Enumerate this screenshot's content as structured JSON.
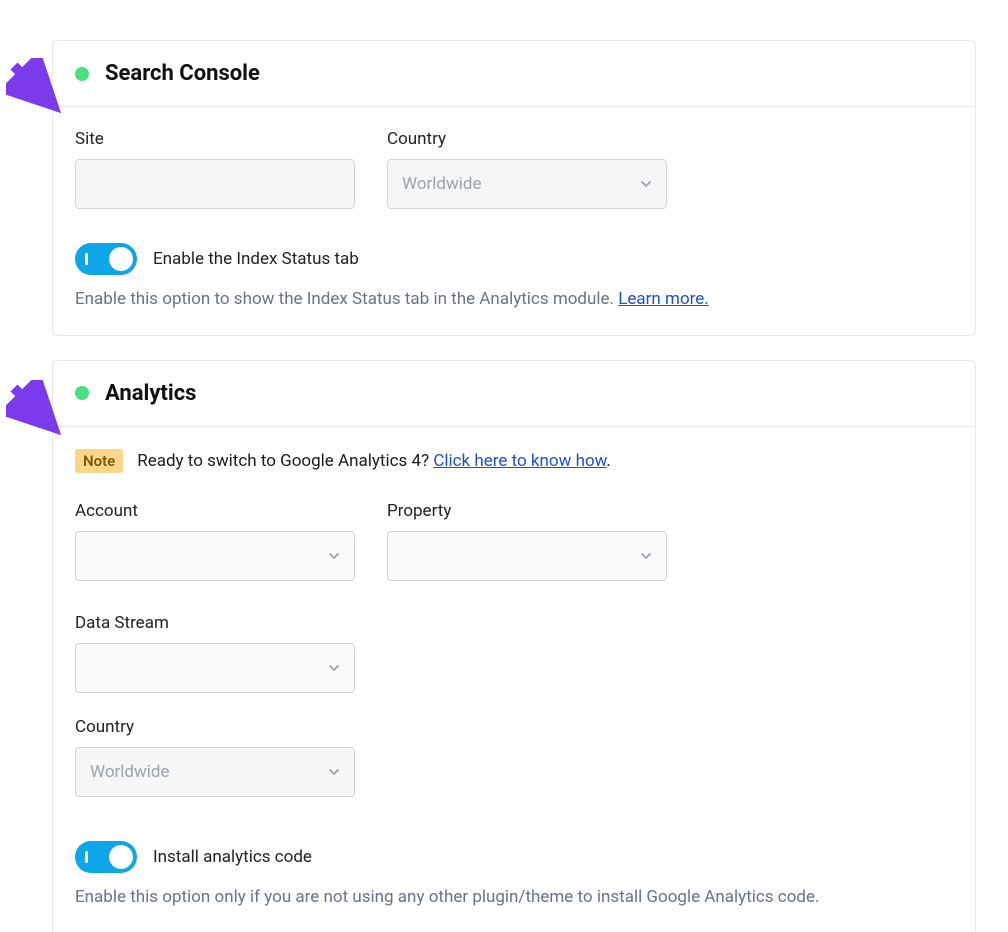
{
  "colors": {
    "status": "#4ade80",
    "toggle": "#0ea5e9",
    "arrow": "#7c3aed",
    "link": "#1d4ed8",
    "badge_bg": "#fcd78a"
  },
  "search_console": {
    "title": "Search Console",
    "site_label": "Site",
    "site_value": "",
    "country_label": "Country",
    "country_value": "Worldwide",
    "toggle_label": "Enable the Index Status tab",
    "toggle_on": true,
    "help_text": "Enable this option to show the Index Status tab in the Analytics module. ",
    "learn_more": "Learn more."
  },
  "analytics": {
    "title": "Analytics",
    "note_badge": "Note",
    "note_text": "Ready to switch to Google Analytics 4? ",
    "note_link": "Click here to know how",
    "note_suffix": ".",
    "account_label": "Account",
    "account_value": "",
    "property_label": "Property",
    "property_value": "",
    "datastream_label": "Data Stream",
    "datastream_value": "",
    "country_label": "Country",
    "country_value": "Worldwide",
    "toggle_label": "Install analytics code",
    "toggle_on": true,
    "help_text": "Enable this option only if you are not using any other plugin/theme to install Google Analytics code."
  }
}
